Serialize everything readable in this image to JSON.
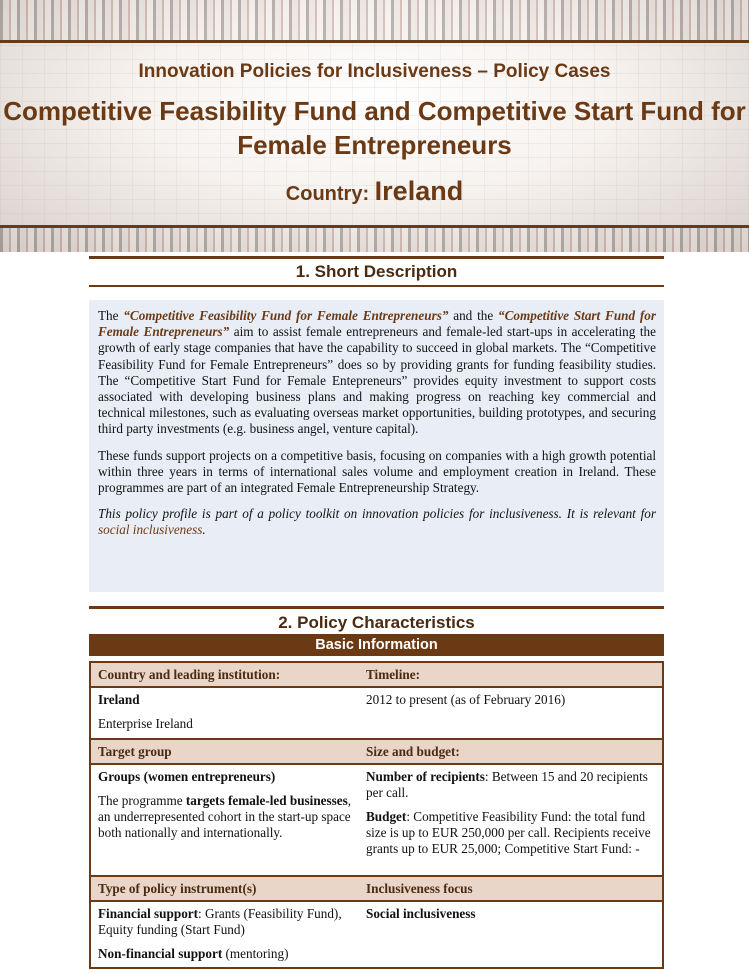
{
  "header": {
    "kicker": "Innovation Policies for Inclusiveness – Policy Cases",
    "title": "Competitive Feasibility Fund and Competitive Start Fund for Female Entrepreneurs",
    "country_label": "Country:",
    "country_value": "Ireland"
  },
  "section1": {
    "heading": "1. Short Description",
    "p1": {
      "t1": "The ",
      "h1": "“Competitive Feasibility Fund for Female Entrepreneurs”",
      "t2": " and the ",
      "h2": "“Competitive Start Fund for Female Entrepreneurs”",
      "t3": " aim to assist female entrepreneurs and female-led start-ups in accelerating the growth of early stage companies that have the capability to succeed in global markets. The “Competitive Feasibility Fund for Female Entrepreneurs” does so by providing grants for funding feasibility studies. The “Competitive Start Fund for Female Entepreneurs” provides equity investment to support costs associated with developing business plans and making progress on reaching key commercial and technical milestones, such as evaluating overseas market opportunities, building prototypes, and securing third party investments (e.g. business angel, venture capital)."
    },
    "p2": "These funds support projects on a competitive basis, focusing on companies with a high growth potential within three years in terms of international sales volume and employment creation in Ireland. These programmes are part of an integrated Female Entrepreneurship Strategy.",
    "p3": {
      "t1": "This policy profile is part of a policy toolkit on innovation policies for inclusiveness. It is relevant for ",
      "link": "social inclusiveness",
      "t2": "."
    }
  },
  "section2": {
    "heading": "2. Policy Characteristics",
    "basic_info_label": "Basic Information",
    "rows": [
      {
        "h1": "Country and leading institution:",
        "h2": "Timeline:",
        "c1_bold": "Ireland",
        "c1_text": "Enterprise Ireland",
        "c2_text": "2012 to present (as of February 2016)"
      },
      {
        "h1": "Target group",
        "h2": "Size and budget:",
        "c1_bold": "Groups (women entrepreneurs)",
        "c1_pre": "The programme ",
        "c1_strong": "targets female-led businesses",
        "c1_post": ", an underrepresented cohort in the start-up space both nationally and internationally.",
        "c2_l1_bold": "Number of recipients",
        "c2_l1_text": ": Between 15 and 20 recipients per call.",
        "c2_l2_bold": "Budget",
        "c2_l2_text": ": Competitive Feasibility Fund: the total fund size is up to EUR 250,000 per call. Recipients receive grants up to EUR 25,000; Competitive Start Fund: -"
      },
      {
        "h1": "Type of policy instrument(s)",
        "h2": "Inclusiveness focus",
        "c1_l1_bold": "Financial support",
        "c1_l1_text": ": Grants (Feasibility Fund), Equity funding (Start Fund)",
        "c1_l2_bold": "Non-financial support",
        "c1_l2_text": " (mentoring)",
        "c2_bold": "Social inclusiveness"
      }
    ]
  },
  "colors": {
    "brand_brown": "#6b3a15",
    "description_bg": "#e9eef6",
    "table_header_bg": "#ead6c8"
  }
}
